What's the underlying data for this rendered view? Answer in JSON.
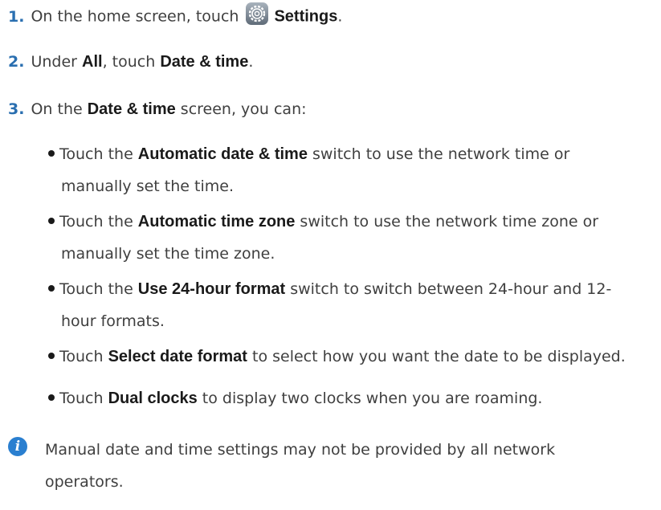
{
  "steps": [
    {
      "num": "1.",
      "pre": "On the home screen, touch",
      "bold": "Settings",
      "post": "."
    },
    {
      "num": "2.",
      "pre": "Under ",
      "bold1": "All",
      "mid": ", touch ",
      "bold2": "Date & time",
      "post": "."
    },
    {
      "num": "3.",
      "pre": "On the ",
      "bold": "Date & time",
      "post": " screen, you can:"
    }
  ],
  "bullets": [
    {
      "pre": "Touch the ",
      "bold": "Automatic date & time",
      "post": " switch to use the network time or",
      "cont": "manually set the time."
    },
    {
      "pre": "Touch the ",
      "bold": "Automatic time zone",
      "post": " switch to use the network time zone or",
      "cont": "manually set the time zone."
    },
    {
      "pre": "Touch the ",
      "bold": "Use 24-hour format",
      "post": " switch to switch between 24-hour and 12-",
      "cont": "hour formats."
    },
    {
      "pre": "Touch ",
      "bold": "Select date format",
      "post": " to select how you want the date to be displayed."
    },
    {
      "pre": "Touch ",
      "bold": "Dual clocks",
      "post": " to display two clocks when you are roaming."
    }
  ],
  "note": {
    "icon": "info-icon",
    "line1": "Manual date and time settings may not be provided by all network",
    "line2": "operators."
  },
  "colors": {
    "step_number": "#2a6fb0",
    "info_icon": "#2a7fd0"
  }
}
